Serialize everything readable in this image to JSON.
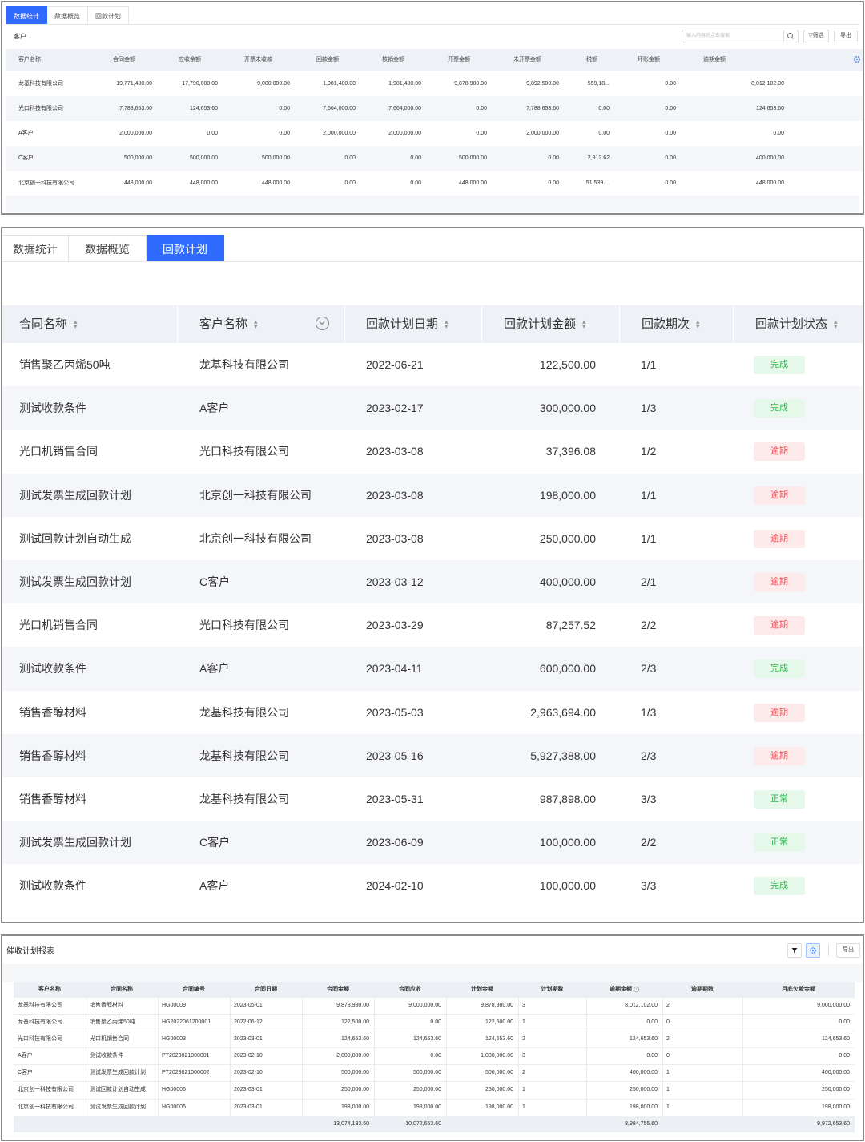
{
  "panel1": {
    "tabs": [
      "数据统计",
      "数据概览",
      "回款计划"
    ],
    "active_tab": 0,
    "filter_label": "客户",
    "search_placeholder": "输入内容后点击搜索",
    "filter_button": "筛选",
    "export_button": "导出",
    "columns": [
      "客户名称",
      "合同金额",
      "应收余额",
      "开票未收款",
      "回款金额",
      "核销金额",
      "开票金额",
      "未开票金额",
      "税额",
      "坏账金额",
      "逾期金额"
    ],
    "rows": [
      [
        "龙基科技有限公司",
        "19,771,480.00",
        "17,790,000.00",
        "9,000,000.00",
        "1,981,480.00",
        "1,981,480.00",
        "9,878,980.00",
        "9,892,500.00",
        "559,18...",
        "0.00",
        "8,012,102.00"
      ],
      [
        "光口科技有限公司",
        "7,788,653.60",
        "124,653.60",
        "0.00",
        "7,664,000.00",
        "7,664,000.00",
        "0.00",
        "7,788,653.60",
        "0.00",
        "0.00",
        "124,653.60"
      ],
      [
        "A客户",
        "2,000,000.00",
        "0.00",
        "0.00",
        "2,000,000.00",
        "2,000,000.00",
        "0.00",
        "2,000,000.00",
        "0.00",
        "0.00",
        "0.00"
      ],
      [
        "C客户",
        "500,000.00",
        "500,000.00",
        "500,000.00",
        "0.00",
        "0.00",
        "500,000.00",
        "0.00",
        "2,912.62",
        "0.00",
        "400,000.00"
      ],
      [
        "北京创一科技有限公司",
        "448,000.00",
        "448,000.00",
        "448,000.00",
        "0.00",
        "0.00",
        "448,000.00",
        "0.00",
        "51,539....",
        "0.00",
        "448,000.00"
      ]
    ]
  },
  "panel2": {
    "tabs": [
      "数据统计",
      "数据概览",
      "回款计划"
    ],
    "active_tab": 2,
    "columns": [
      "合同名称",
      "客户名称",
      "回款计划日期",
      "回款计划金额",
      "回款期次",
      "回款计划状态"
    ],
    "rows": [
      {
        "contract": "销售聚乙丙烯50吨",
        "customer": "龙基科技有限公司",
        "date": "2022-06-21",
        "amount": "122,500.00",
        "period": "1/1",
        "status": "完成",
        "color": "green"
      },
      {
        "contract": "测试收款条件",
        "customer": "A客户",
        "date": "2023-02-17",
        "amount": "300,000.00",
        "period": "1/3",
        "status": "完成",
        "color": "green"
      },
      {
        "contract": "光口机销售合同",
        "customer": "光口科技有限公司",
        "date": "2023-03-08",
        "amount": "37,396.08",
        "period": "1/2",
        "status": "逾期",
        "color": "red"
      },
      {
        "contract": "测试发票生成回款计划",
        "customer": "北京创一科技有限公司",
        "date": "2023-03-08",
        "amount": "198,000.00",
        "period": "1/1",
        "status": "逾期",
        "color": "red"
      },
      {
        "contract": "测试回款计划自动生成",
        "customer": "北京创一科技有限公司",
        "date": "2023-03-08",
        "amount": "250,000.00",
        "period": "1/1",
        "status": "逾期",
        "color": "red"
      },
      {
        "contract": "测试发票生成回款计划",
        "customer": "C客户",
        "date": "2023-03-12",
        "amount": "400,000.00",
        "period": "2/1",
        "status": "逾期",
        "color": "red"
      },
      {
        "contract": "光口机销售合同",
        "customer": "光口科技有限公司",
        "date": "2023-03-29",
        "amount": "87,257.52",
        "period": "2/2",
        "status": "逾期",
        "color": "red"
      },
      {
        "contract": "测试收款条件",
        "customer": "A客户",
        "date": "2023-04-11",
        "amount": "600,000.00",
        "period": "2/3",
        "status": "完成",
        "color": "green"
      },
      {
        "contract": "销售香醇材料",
        "customer": "龙基科技有限公司",
        "date": "2023-05-03",
        "amount": "2,963,694.00",
        "period": "1/3",
        "status": "逾期",
        "color": "red"
      },
      {
        "contract": "销售香醇材料",
        "customer": "龙基科技有限公司",
        "date": "2023-05-16",
        "amount": "5,927,388.00",
        "period": "2/3",
        "status": "逾期",
        "color": "red"
      },
      {
        "contract": "销售香醇材料",
        "customer": "龙基科技有限公司",
        "date": "2023-05-31",
        "amount": "987,898.00",
        "period": "3/3",
        "status": "正常",
        "color": "green"
      },
      {
        "contract": "测试发票生成回款计划",
        "customer": "C客户",
        "date": "2023-06-09",
        "amount": "100,000.00",
        "period": "2/2",
        "status": "正常",
        "color": "green"
      },
      {
        "contract": "测试收款条件",
        "customer": "A客户",
        "date": "2024-02-10",
        "amount": "100,000.00",
        "period": "3/3",
        "status": "完成",
        "color": "green"
      }
    ]
  },
  "panel3": {
    "title": "催收计划报表",
    "export_button": "导出",
    "columns": [
      "客户名称",
      "合同名称",
      "合同编号",
      "合同日期",
      "合同金额",
      "合同应收",
      "计划金额",
      "计划期数",
      "逾期金额",
      "逾期期数",
      "月底欠款金额"
    ],
    "rows": [
      [
        "龙基科技有限公司",
        "销售香醇材料",
        "HG00009",
        "2023-05-01",
        "9,878,980.00",
        "9,000,000.00",
        "9,878,980.00",
        "3",
        "8,012,102.00",
        "2",
        "9,000,000.00"
      ],
      [
        "龙基科技有限公司",
        "销售聚乙丙烯50吨",
        "HG2022061200001",
        "2022-06-12",
        "122,500.00",
        "0.00",
        "122,500.00",
        "1",
        "0.00",
        "0",
        "0.00"
      ],
      [
        "光口科技有限公司",
        "光口机销售合同",
        "HG00003",
        "2023-03-01",
        "124,653.60",
        "124,653.60",
        "124,653.60",
        "2",
        "124,653.60",
        "2",
        "124,653.60"
      ],
      [
        "A客户",
        "测试收款条件",
        "PT2023021000001",
        "2023-02-10",
        "2,000,000.00",
        "0.00",
        "1,000,000.00",
        "3",
        "0.00",
        "0",
        "0.00"
      ],
      [
        "C客户",
        "测试发票生成回款计划",
        "PT2023021000002",
        "2023-02-10",
        "500,000.00",
        "500,000.00",
        "500,000.00",
        "2",
        "400,000.00",
        "1",
        "400,000.00"
      ],
      [
        "北京创一科技有限公司",
        "测试回款计划自动生成",
        "HG00006",
        "2023-03-01",
        "250,000.00",
        "250,000.00",
        "250,000.00",
        "1",
        "250,000.00",
        "1",
        "250,000.00"
      ],
      [
        "北京创一科技有限公司",
        "测试发票生成回款计划",
        "HG00005",
        "2023-03-01",
        "198,000.00",
        "198,000.00",
        "198,000.00",
        "1",
        "198,000.00",
        "1",
        "198,000.00"
      ]
    ],
    "totals": {
      "contract_amount": "13,074,133.60",
      "receivable": "10,072,653.60",
      "overdue": "8,984,755.60",
      "month_end": "9,972,653.60"
    }
  }
}
